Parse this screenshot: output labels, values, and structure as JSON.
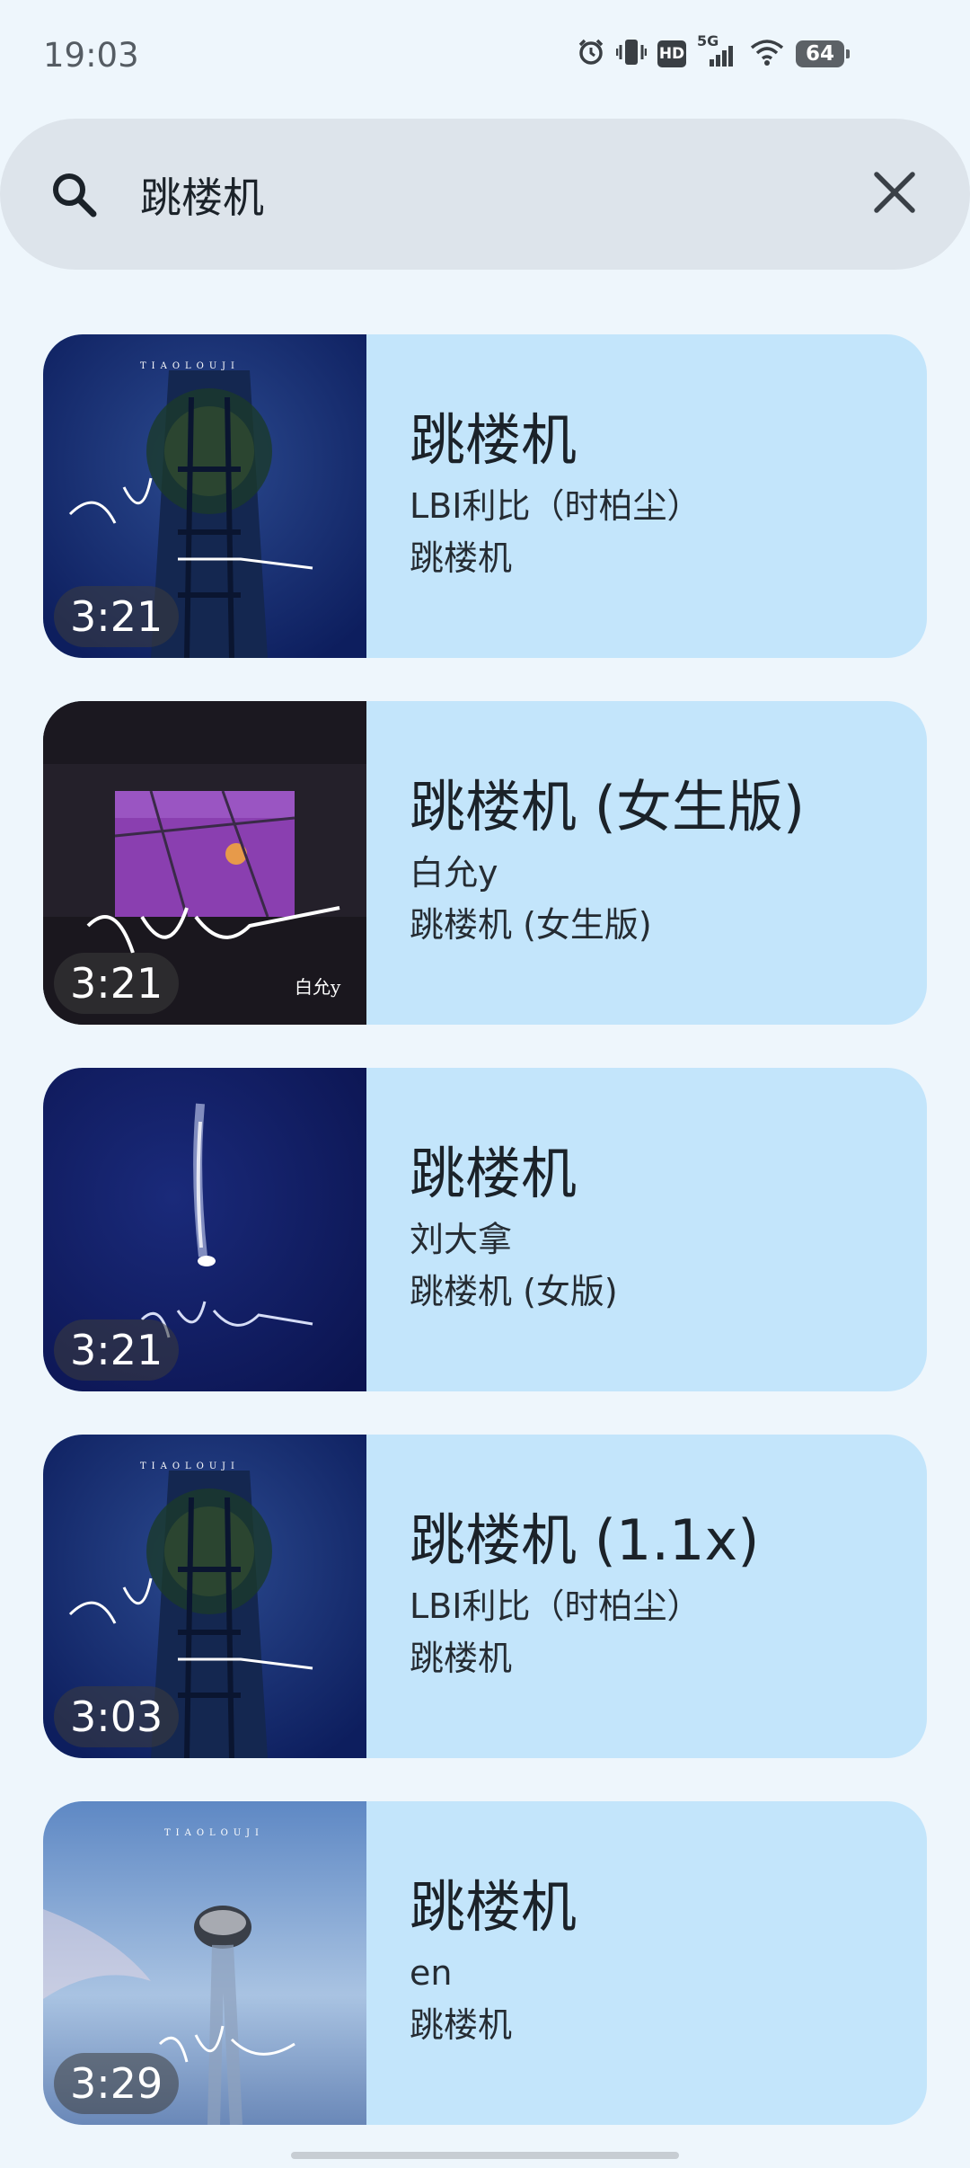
{
  "status_bar": {
    "time": "19:03",
    "network": "5G",
    "hd": "HD",
    "battery": "64",
    "icons": [
      "alarm-icon",
      "vibrate-icon",
      "hd-icon",
      "signal-icon",
      "wifi-icon",
      "battery-icon"
    ]
  },
  "search": {
    "query": "跳楼机",
    "icons": [
      "search-icon",
      "close-icon"
    ]
  },
  "results": [
    {
      "title": "跳楼机",
      "artist": "LBI利比（时柏尘）",
      "album": "跳楼机",
      "duration": "3:21"
    },
    {
      "title": "跳楼机 (女生版)",
      "artist": "白允y",
      "album": "跳楼机 (女生版)",
      "duration": "3:21"
    },
    {
      "title": "跳楼机",
      "artist": "刘大拿",
      "album": "跳楼机 (女版)",
      "duration": "3:21"
    },
    {
      "title": "跳楼机 (1.1x)",
      "artist": "LBI利比（时柏尘）",
      "album": "跳楼机",
      "duration": "3:03"
    },
    {
      "title": "跳楼机",
      "artist": "en",
      "album": "跳楼机",
      "duration": "3:29"
    }
  ],
  "colors": {
    "background": "#EEF6FC",
    "search_bar": "#DDE4EB",
    "card": "#C3E5FB"
  }
}
